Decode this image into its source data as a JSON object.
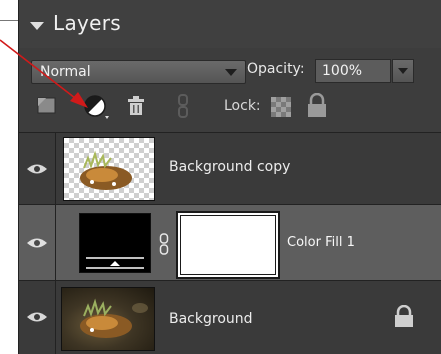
{
  "panel": {
    "title": "Layers"
  },
  "controls": {
    "blend_mode": "Normal",
    "opacity_label": "Opacity:",
    "opacity_value": "100%",
    "lock_label": "Lock:"
  },
  "layers": [
    {
      "name": "Background copy",
      "visible": true,
      "thumbnail": "fish-on-transparency",
      "selected": false
    },
    {
      "name": "Color Fill 1",
      "visible": true,
      "thumbnail": "fill-adjustment-with-mask",
      "selected": true
    },
    {
      "name": "Background",
      "visible": true,
      "thumbnail": "fish-photo",
      "selected": false,
      "locked": true
    }
  ],
  "icons": {
    "panel_toggle": "triangle-down-icon",
    "new_layer": "new-layer-icon",
    "adjustment": "adjustment-layer-icon",
    "delete": "trash-icon",
    "link": "link-icon",
    "lock_transparent": "lock-transparent-icon",
    "lock_all": "lock-icon",
    "visibility": "eye-icon",
    "annotation": "red-arrow-icon"
  },
  "colors": {
    "panel_bg": "#3d3d3d",
    "selected_row": "#5e5e5e",
    "annotation_arrow": "#d11a1a"
  }
}
